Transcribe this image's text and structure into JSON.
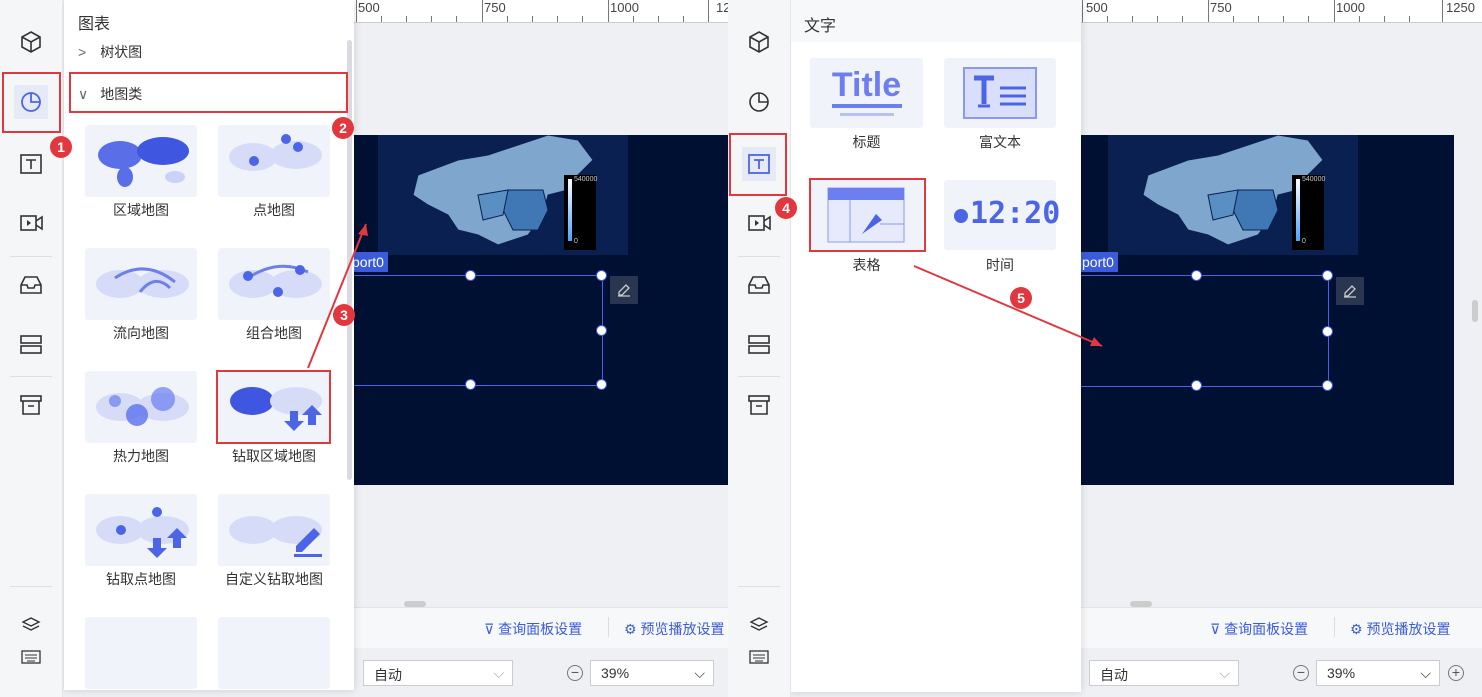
{
  "left_scene": {
    "panel_title": "图表",
    "tree_items": [
      {
        "label": "树状图",
        "expanded": false
      },
      {
        "label": "地图类",
        "expanded": true
      }
    ],
    "maps": [
      {
        "label": "区域地图",
        "icon": "region-map-icon"
      },
      {
        "label": "点地图",
        "icon": "point-map-icon"
      },
      {
        "label": "流向地图",
        "icon": "flow-map-icon"
      },
      {
        "label": "组合地图",
        "icon": "combined-map-icon"
      },
      {
        "label": "热力地图",
        "icon": "heat-map-icon"
      },
      {
        "label": "钻取区域地图",
        "icon": "drill-region-map-icon"
      },
      {
        "label": "钻取点地图",
        "icon": "drill-point-map-icon"
      },
      {
        "label": "自定义钻取地图",
        "icon": "custom-drill-map-icon"
      }
    ],
    "report_tag": "port0",
    "ruler_labels": [
      "500",
      "750",
      "1000",
      "12"
    ],
    "query_panel_link": "查询面板设置",
    "preview_link": "预览播放设置",
    "auto_select": "自动",
    "zoom_value": "39%"
  },
  "right_scene": {
    "panel_title": "文字",
    "items": [
      {
        "label": "标题",
        "icon": "title-icon",
        "art": "Title"
      },
      {
        "label": "富文本",
        "icon": "rich-text-icon"
      },
      {
        "label": "表格",
        "icon": "table-icon"
      },
      {
        "label": "时间",
        "icon": "time-icon",
        "art": "12:20"
      }
    ],
    "report_tag": "port0",
    "ruler_labels": [
      "500",
      "750",
      "1000",
      "1250"
    ],
    "query_panel_link": "查询面板设置",
    "preview_link": "预览播放设置",
    "auto_select": "自动",
    "zoom_value": "39%"
  },
  "legend": {
    "max": "540000",
    "min": "0"
  },
  "steps": [
    "1",
    "2",
    "3",
    "4",
    "5"
  ],
  "colors": {
    "accent": "#3b5bdb",
    "highlight": "#e0383e",
    "canvas": "#001033"
  }
}
